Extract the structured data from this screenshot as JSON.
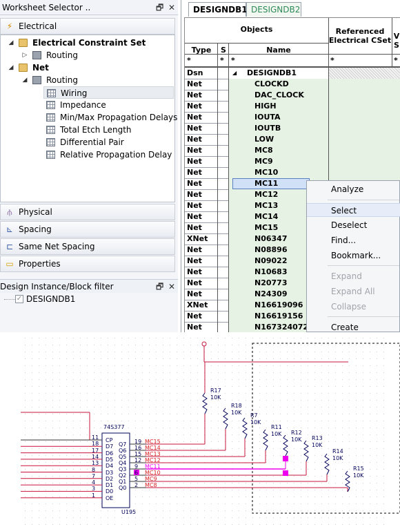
{
  "worksheet_selector": {
    "title": "Worksheet Selector ..",
    "electrical_label": "Electrical",
    "tree": {
      "constraint_set": "Electrical Constraint Set",
      "constraint_routing": "Routing",
      "net": "Net",
      "net_routing": "Routing",
      "items": [
        "Wiring",
        "Impedance",
        "Min/Max Propagation Delays",
        "Total Etch Length",
        "Differential Pair",
        "Relative Propagation Delay"
      ]
    },
    "bottom_sections": [
      "Physical",
      "Spacing",
      "Same Net Spacing",
      "Properties"
    ]
  },
  "filter": {
    "title": "Design Instance/Block filter",
    "item": "DESIGNDB1"
  },
  "tabs": [
    "DESIGNDB1",
    "DESIGNDB2"
  ],
  "grid": {
    "objects_header": "Objects",
    "type_header": "Type",
    "s_header": "S",
    "name_header": "Name",
    "ref_header_1": "Referenced",
    "ref_header_2": "Electrical CSet",
    "clip_header_1": "V",
    "clip_header_2": "S",
    "filter_char": "*",
    "rows": [
      {
        "type": "Dsn",
        "name": "DESIGNDB1"
      },
      {
        "type": "Net",
        "name": "CLOCKD"
      },
      {
        "type": "Net",
        "name": "DAC_CLOCK"
      },
      {
        "type": "Net",
        "name": "HIGH"
      },
      {
        "type": "Net",
        "name": "IOUTA"
      },
      {
        "type": "Net",
        "name": "IOUTB"
      },
      {
        "type": "Net",
        "name": "LOW"
      },
      {
        "type": "Net",
        "name": "MC8"
      },
      {
        "type": "Net",
        "name": "MC9"
      },
      {
        "type": "Net",
        "name": "MC10"
      },
      {
        "type": "Net",
        "name": "MC11"
      },
      {
        "type": "Net",
        "name": "MC12"
      },
      {
        "type": "Net",
        "name": "MC13"
      },
      {
        "type": "Net",
        "name": "MC14"
      },
      {
        "type": "Net",
        "name": "MC15"
      },
      {
        "type": "XNet",
        "name": "N06347"
      },
      {
        "type": "Net",
        "name": "N08896"
      },
      {
        "type": "Net",
        "name": "N09022"
      },
      {
        "type": "Net",
        "name": "N10683"
      },
      {
        "type": "Net",
        "name": "N20773"
      },
      {
        "type": "Net",
        "name": "N24309"
      },
      {
        "type": "XNet",
        "name": "N16619096"
      },
      {
        "type": "Net",
        "name": "N16619156"
      },
      {
        "type": "Net",
        "name": "N167324072"
      }
    ]
  },
  "context_menu": {
    "items": [
      "Analyze",
      "Select",
      "Deselect",
      "Find...",
      "Bookmark...",
      "Expand",
      "Expand All",
      "Collapse",
      "Create"
    ]
  },
  "schematic": {
    "chip_name": "74S377",
    "chip_ref": "U195",
    "left_pins": [
      {
        "num": "11",
        "name": "CP"
      },
      {
        "num": "18",
        "name": "D7"
      },
      {
        "num": "17",
        "name": "D6"
      },
      {
        "num": "14",
        "name": "D5"
      },
      {
        "num": "13",
        "name": "D4"
      },
      {
        "num": "8",
        "name": "D3"
      },
      {
        "num": "7",
        "name": "D2"
      },
      {
        "num": "4",
        "name": "D1"
      },
      {
        "num": "3",
        "name": "D0"
      },
      {
        "num": "1",
        "name": "OE"
      }
    ],
    "right_pins": [
      {
        "num": "19",
        "name": "Q7",
        "net": "MC15"
      },
      {
        "num": "16",
        "name": "Q6",
        "net": "MC14"
      },
      {
        "num": "15",
        "name": "Q5",
        "net": "MC13"
      },
      {
        "num": "12",
        "name": "Q4",
        "net": "MC12"
      },
      {
        "num": "9",
        "name": "Q3",
        "net": "MC11"
      },
      {
        "num": "6",
        "name": "Q2",
        "net": "MC10"
      },
      {
        "num": "5",
        "name": "Q1",
        "net": "MC9"
      },
      {
        "num": "2",
        "name": "Q0",
        "net": "MC8"
      }
    ],
    "resistors": [
      {
        "ref": "R17",
        "value": "10K"
      },
      {
        "ref": "R18",
        "value": "10K"
      },
      {
        "ref": "R7",
        "value": "10K"
      },
      {
        "ref": "R11",
        "value": "10K"
      },
      {
        "ref": "R12",
        "value": "10K"
      },
      {
        "ref": "R13",
        "value": "10K"
      },
      {
        "ref": "R14",
        "value": "10K"
      },
      {
        "ref": "R15",
        "value": "10K"
      }
    ]
  },
  "colors": {
    "row_green": "#e6f2e4",
    "row_selected": "#cfe0f7",
    "header_bg": "#ffffff",
    "wire_red": "#c8143c",
    "net_label": "#d82020",
    "net_highlight": "#ee00ee",
    "pin_text": "#00005a"
  }
}
